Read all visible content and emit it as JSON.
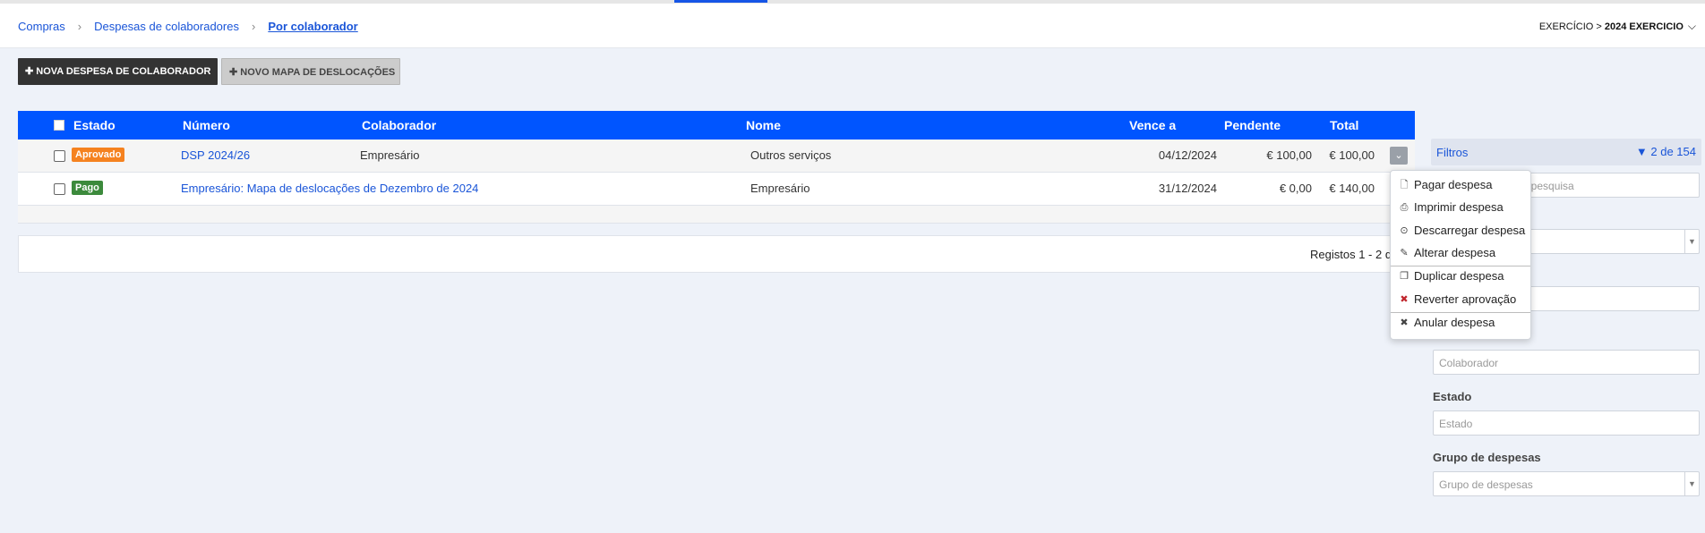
{
  "breadcrumb": {
    "items": [
      "Compras",
      "Despesas de colaboradores",
      "Por colaborador"
    ],
    "sep": ">"
  },
  "exercise": {
    "prefix": "EXERCÍCIO >",
    "value": "2024 EXERCICIO"
  },
  "toolbar": {
    "new_expense_label": "NOVA DESPESA DE COLABORADOR",
    "new_map_label": "NOVO MAPA DE DESLOCAÇÕES",
    "plus": "✚"
  },
  "table": {
    "columns": [
      "Estado",
      "Número",
      "Colaborador",
      "Nome",
      "Vence a",
      "Pendente",
      "Total"
    ],
    "rows": [
      {
        "status": "Aprovado",
        "status_color": "#f58220",
        "number": "DSP 2024/26",
        "collaborator": "Empresário",
        "name": "Outros serviços",
        "due": "04/12/2024",
        "pending": "€ 100,00",
        "total": "€ 100,00"
      },
      {
        "status": "Pago",
        "status_color": "#3c8a3c",
        "number": "Empresário: Mapa de deslocações de Dezembro de 2024",
        "collaborator": "",
        "name": "Empresário",
        "due": "31/12/2024",
        "pending": "€ 0,00",
        "total": "€ 140,00"
      }
    ]
  },
  "pager": {
    "text": "Registos 1 - 2 d"
  },
  "filters": {
    "title": "Filtros",
    "count": "2 de 154",
    "search_placeholder": "de pesquisa",
    "collaborator_placeholder": "Colaborador",
    "state_label": "Estado",
    "state_placeholder": "Estado",
    "group_label": "Grupo de despesas",
    "group_placeholder": "Grupo de despesas"
  },
  "context_menu": {
    "items": [
      {
        "label": "Pagar despesa",
        "icon": "document-icon"
      },
      {
        "label": "Imprimir despesa",
        "icon": "printer-icon"
      },
      {
        "label": "Descarregar despesa",
        "icon": "download-icon"
      },
      {
        "label": "Alterar despesa",
        "icon": "pencil-icon"
      },
      {
        "label": "Duplicar despesa",
        "icon": "copy-icon"
      },
      {
        "label": "Reverter aprovação",
        "icon": "red-x-icon"
      },
      {
        "label": "Anular despesa",
        "icon": "x-icon"
      }
    ]
  }
}
